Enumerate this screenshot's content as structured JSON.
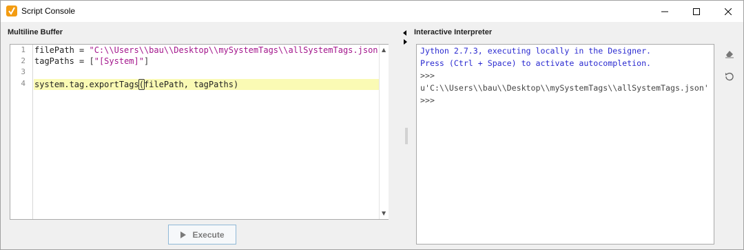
{
  "window": {
    "title": "Script Console",
    "icon": "ignition-app-icon",
    "controls": {
      "minimize": "minimize-icon",
      "maximize": "maximize-icon",
      "close": "close-icon"
    }
  },
  "buffer": {
    "label": "Multiline Buffer",
    "line_numbers": [
      "1",
      "2",
      "3",
      "4"
    ],
    "lines": {
      "l1_name": "filePath = ",
      "l1_str": "\"C:\\\\Users\\\\bau\\\\Desktop\\\\mySystemTags\\\\allSystemTags.json\"",
      "l2_name": "tagPaths = ",
      "l2_open": "[",
      "l2_str": "\"[System]\"",
      "l2_close": "]",
      "l4_pre": "system.tag.exportTags",
      "l4_paren": "(",
      "l4_post": "filePath, tagPaths)"
    },
    "execute_label": "Execute"
  },
  "interpreter": {
    "label": "Interactive Interpreter",
    "lines": [
      "Jython 2.7.3, executing locally in the Designer.",
      "Press (Ctrl + Space) to activate autocompletion.",
      ">>>",
      "u'C:\\\\Users\\\\bau\\\\Desktop\\\\mySystemTags\\\\allSystemTags.json'",
      ">>>"
    ],
    "tools": [
      "eraser-icon",
      "reset-icon"
    ]
  },
  "colors": {
    "string": "#a3158c",
    "console_info": "#2a2ad0",
    "current_line": "#fafab4",
    "app_icon": "#f39c12"
  }
}
